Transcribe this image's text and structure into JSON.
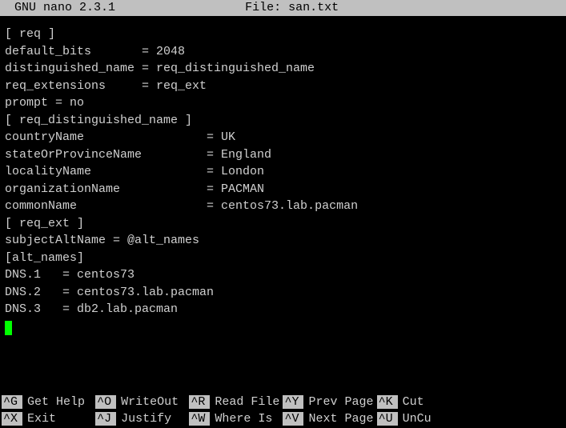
{
  "titlebar": {
    "left": "  GNU nano 2.3.1",
    "center": "File: san.txt"
  },
  "file": {
    "lines": [
      "[ req ]",
      "default_bits       = 2048",
      "distinguished_name = req_distinguished_name",
      "req_extensions     = req_ext",
      "prompt = no",
      "[ req_distinguished_name ]",
      "countryName                 = UK",
      "stateOrProvinceName         = England",
      "localityName                = London",
      "organizationName            = PACMAN",
      "commonName                  = centos73.lab.pacman",
      "[ req_ext ]",
      "subjectAltName = @alt_names",
      "[alt_names]",
      "DNS.1   = centos73",
      "DNS.2   = centos73.lab.pacman",
      "DNS.3   = db2.lab.pacman"
    ]
  },
  "shortcuts": [
    {
      "key": "^G",
      "label": "Get Help"
    },
    {
      "key": "^O",
      "label": "WriteOut"
    },
    {
      "key": "^R",
      "label": "Read File"
    },
    {
      "key": "^Y",
      "label": "Prev Page"
    },
    {
      "key": "^K",
      "label": "Cut"
    },
    {
      "key": "^X",
      "label": "Exit"
    },
    {
      "key": "^J",
      "label": "Justify"
    },
    {
      "key": "^W",
      "label": "Where Is"
    },
    {
      "key": "^V",
      "label": "Next Page"
    },
    {
      "key": "^U",
      "label": "UnCu"
    }
  ]
}
